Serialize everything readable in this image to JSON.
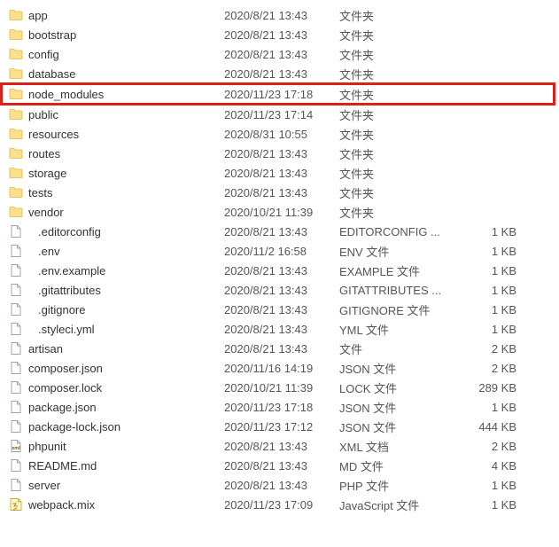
{
  "files": [
    {
      "icon": "folder",
      "name": "app",
      "date": "2020/8/21 13:43",
      "type": "文件夹",
      "size": "",
      "hl": false,
      "indent": false
    },
    {
      "icon": "folder",
      "name": "bootstrap",
      "date": "2020/8/21 13:43",
      "type": "文件夹",
      "size": "",
      "hl": false,
      "indent": false
    },
    {
      "icon": "folder",
      "name": "config",
      "date": "2020/8/21 13:43",
      "type": "文件夹",
      "size": "",
      "hl": false,
      "indent": false
    },
    {
      "icon": "folder",
      "name": "database",
      "date": "2020/8/21 13:43",
      "type": "文件夹",
      "size": "",
      "hl": false,
      "indent": false
    },
    {
      "icon": "folder",
      "name": "node_modules",
      "date": "2020/11/23 17:18",
      "type": "文件夹",
      "size": "",
      "hl": true,
      "indent": false
    },
    {
      "icon": "folder",
      "name": "public",
      "date": "2020/11/23 17:14",
      "type": "文件夹",
      "size": "",
      "hl": false,
      "indent": false
    },
    {
      "icon": "folder",
      "name": "resources",
      "date": "2020/8/31 10:55",
      "type": "文件夹",
      "size": "",
      "hl": false,
      "indent": false
    },
    {
      "icon": "folder",
      "name": "routes",
      "date": "2020/8/21 13:43",
      "type": "文件夹",
      "size": "",
      "hl": false,
      "indent": false
    },
    {
      "icon": "folder",
      "name": "storage",
      "date": "2020/8/21 13:43",
      "type": "文件夹",
      "size": "",
      "hl": false,
      "indent": false
    },
    {
      "icon": "folder",
      "name": "tests",
      "date": "2020/8/21 13:43",
      "type": "文件夹",
      "size": "",
      "hl": false,
      "indent": false
    },
    {
      "icon": "folder",
      "name": "vendor",
      "date": "2020/10/21 11:39",
      "type": "文件夹",
      "size": "",
      "hl": false,
      "indent": false
    },
    {
      "icon": "file",
      "name": ".editorconfig",
      "date": "2020/8/21 13:43",
      "type": "EDITORCONFIG ...",
      "size": "1 KB",
      "hl": false,
      "indent": true
    },
    {
      "icon": "file",
      "name": ".env",
      "date": "2020/11/2 16:58",
      "type": "ENV 文件",
      "size": "1 KB",
      "hl": false,
      "indent": true
    },
    {
      "icon": "file",
      "name": ".env.example",
      "date": "2020/8/21 13:43",
      "type": "EXAMPLE 文件",
      "size": "1 KB",
      "hl": false,
      "indent": true
    },
    {
      "icon": "file",
      "name": ".gitattributes",
      "date": "2020/8/21 13:43",
      "type": "GITATTRIBUTES ...",
      "size": "1 KB",
      "hl": false,
      "indent": true
    },
    {
      "icon": "file",
      "name": ".gitignore",
      "date": "2020/8/21 13:43",
      "type": "GITIGNORE 文件",
      "size": "1 KB",
      "hl": false,
      "indent": true
    },
    {
      "icon": "file",
      "name": ".styleci.yml",
      "date": "2020/8/21 13:43",
      "type": "YML 文件",
      "size": "1 KB",
      "hl": false,
      "indent": true
    },
    {
      "icon": "file",
      "name": "artisan",
      "date": "2020/8/21 13:43",
      "type": "文件",
      "size": "2 KB",
      "hl": false,
      "indent": false
    },
    {
      "icon": "file",
      "name": "composer.json",
      "date": "2020/11/16 14:19",
      "type": "JSON 文件",
      "size": "2 KB",
      "hl": false,
      "indent": false
    },
    {
      "icon": "file",
      "name": "composer.lock",
      "date": "2020/10/21 11:39",
      "type": "LOCK 文件",
      "size": "289 KB",
      "hl": false,
      "indent": false
    },
    {
      "icon": "file",
      "name": "package.json",
      "date": "2020/11/23 17:18",
      "type": "JSON 文件",
      "size": "1 KB",
      "hl": false,
      "indent": false
    },
    {
      "icon": "file",
      "name": "package-lock.json",
      "date": "2020/11/23 17:12",
      "type": "JSON 文件",
      "size": "444 KB",
      "hl": false,
      "indent": false
    },
    {
      "icon": "xml",
      "name": "phpunit",
      "date": "2020/8/21 13:43",
      "type": "XML 文档",
      "size": "2 KB",
      "hl": false,
      "indent": false
    },
    {
      "icon": "file",
      "name": "README.md",
      "date": "2020/8/21 13:43",
      "type": "MD 文件",
      "size": "4 KB",
      "hl": false,
      "indent": false
    },
    {
      "icon": "file",
      "name": "server",
      "date": "2020/8/21 13:43",
      "type": "PHP 文件",
      "size": "1 KB",
      "hl": false,
      "indent": false
    },
    {
      "icon": "js",
      "name": "webpack.mix",
      "date": "2020/11/23 17:09",
      "type": "JavaScript 文件",
      "size": "1 KB",
      "hl": false,
      "indent": false
    }
  ]
}
